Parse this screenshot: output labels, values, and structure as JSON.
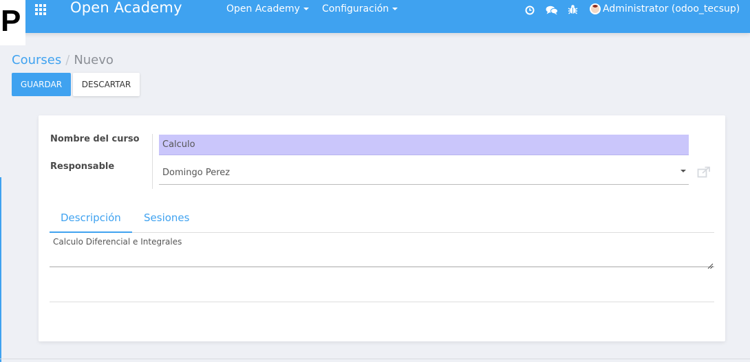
{
  "corner_logo": {
    "text": "P"
  },
  "navbar": {
    "brand": "Open Academy",
    "menus": [
      {
        "label": "Open Academy"
      },
      {
        "label": "Configuración"
      }
    ],
    "icons": [
      "clock-icon",
      "chat-icon",
      "bug-icon"
    ],
    "user": "Administrator (odoo_tecsup)",
    "accent_color": "#3fa2f0"
  },
  "breadcrumb": {
    "parent": "Courses",
    "separator": "/",
    "current": "Nuevo"
  },
  "buttons": {
    "save": "GUARDAR",
    "discard": "DESCARTAR"
  },
  "form": {
    "name_label": "Nombre del curso",
    "name_value": "Calculo",
    "responsible_label": "Responsable",
    "responsible_value": "Domingo Perez",
    "highlight_color": "#cac6fb"
  },
  "tabs": [
    {
      "label": "Descripción",
      "active": true
    },
    {
      "label": "Sesiones",
      "active": false
    }
  ],
  "description": {
    "value": "Calculo Diferencial e Integrales"
  }
}
